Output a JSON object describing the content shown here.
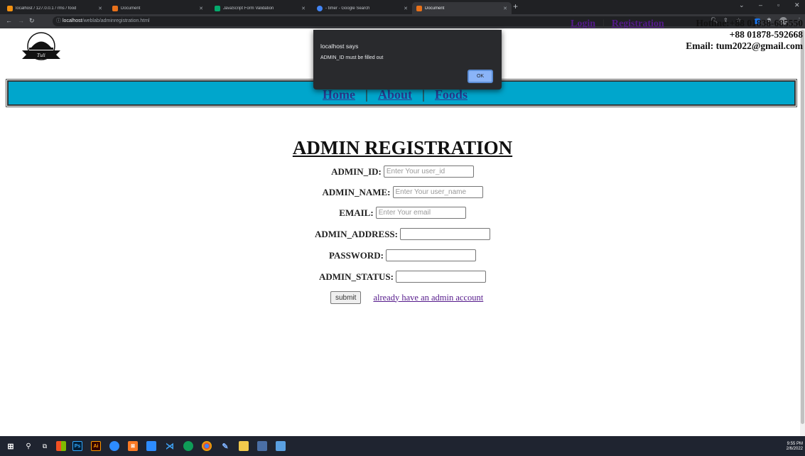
{
  "browser": {
    "tabs": [
      {
        "title": "localhost / 127.0.0.1 / rms / food",
        "fav_color": "#f29111",
        "active": false
      },
      {
        "title": "Document",
        "fav_color": "#e8711a",
        "active": false
      },
      {
        "title": "JavaScript Form Validation",
        "fav_color": "#04aa6d",
        "active": false
      },
      {
        "title": "- timer - Google Search",
        "fav_color": "#4285f4",
        "active": false
      },
      {
        "title": "Document",
        "fav_color": "#e8711a",
        "active": true
      }
    ],
    "url_host": "localhost",
    "url_path": "/weblab/adminregistration.html"
  },
  "header": {
    "login_label": "Login",
    "separator": "|",
    "registration_label": "Registration",
    "hotline_line1": "Hotline:+88 01838-685550",
    "hotline_line2": "+88 01878-592668",
    "email_line": "Email: tum2022@gmail.com"
  },
  "nav": {
    "home_label": "Home",
    "about_label": "About",
    "foods_label": "Foods",
    "separator": "|"
  },
  "form": {
    "title": "ADMIN REGISTRATION",
    "fields": [
      {
        "label": "ADMIN_ID:",
        "placeholder": "Enter Your user_id"
      },
      {
        "label": "ADMIN_NAME:",
        "placeholder": "Enter Your user_name"
      },
      {
        "label": "EMAIL:",
        "placeholder": "Enter Your email"
      },
      {
        "label": "ADMIN_ADDRESS:",
        "placeholder": ""
      },
      {
        "label": "PASSWORD:",
        "placeholder": ""
      },
      {
        "label": "ADMIN_STATUS:",
        "placeholder": ""
      }
    ],
    "submit_label": "submit",
    "login_link": "already have an admin account"
  },
  "dialog": {
    "title": "localhost says",
    "message": "ADMIN_ID must be filled out",
    "ok_label": "OK"
  },
  "taskbar": {
    "time": "9:55 PM",
    "date": "2/6/2022"
  }
}
